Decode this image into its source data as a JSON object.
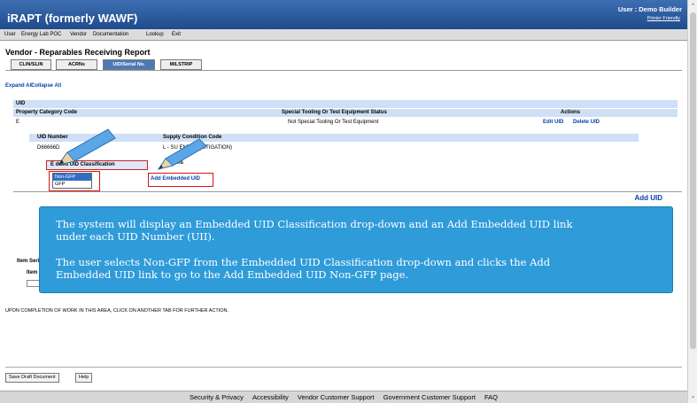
{
  "header": {
    "app_title": "iRAPT (formerly WAWF)",
    "user": "User : Demo Builder",
    "printer_friendly": "Printer Friendly"
  },
  "menu": [
    "User",
    "Energy Lab POC",
    "Vendor",
    "Documentation",
    "Lookup",
    "Exit"
  ],
  "page_title": "Vendor - Reparables Receiving Report",
  "tabs": [
    "CLIN/SLIN",
    "ACRNs",
    "UID/Serial No.",
    "MILSTRIP"
  ],
  "active_tab": "UID/Serial No.",
  "links": {
    "expand_all": "Expand All",
    "collapse_all": "Collapse All"
  },
  "uid_section": {
    "label": "UID",
    "col_property": "Property Category Code",
    "col_special": "Special Tooling Or Test Equipment Status",
    "col_actions": "Actions",
    "row_code": "E",
    "row_status": "Not Special Tooling Or Test Equipment",
    "edit_uid": "Edit UID",
    "delete_uid": "Delete UID"
  },
  "uid_sub": {
    "col_uid_number": "UID Number",
    "col_supply": "Supply Condition Code",
    "uid_value": "D66666D",
    "supply_value": "L - SU     ENDED (LITIGATION)"
  },
  "embedded": {
    "header": "E       dded UID Classification",
    "actions": "Actions",
    "options": [
      "Non-GFP",
      "GFP"
    ],
    "selected": "Non-GFP",
    "add_link": "Add Embedded UID"
  },
  "add_uid": "Add UID",
  "item_section": {
    "label": "Item Seri",
    "item": "Item"
  },
  "notice": "UPON COMPLETION OF WORK IN THIS AREA, CLICK ON ANOTHER TAB FOR FURTHER ACTION.",
  "buttons": {
    "save_draft": "Save Draft Document",
    "help": "Help"
  },
  "footer": [
    "Security & Privacy",
    "Accessibility",
    "Vendor Customer Support",
    "Government Customer Support",
    "FAQ"
  ],
  "callout": {
    "line1": "The system will display an Embedded UID Classification drop-down and an Add Embedded UID link",
    "line2": "under each UID Number (UII).",
    "line3": "The user selects Non-GFP from the Embedded UID Classification drop-down and clicks the Add",
    "line4": "Embedded UID link to go to the Add Embedded UID Non-GFP page."
  }
}
